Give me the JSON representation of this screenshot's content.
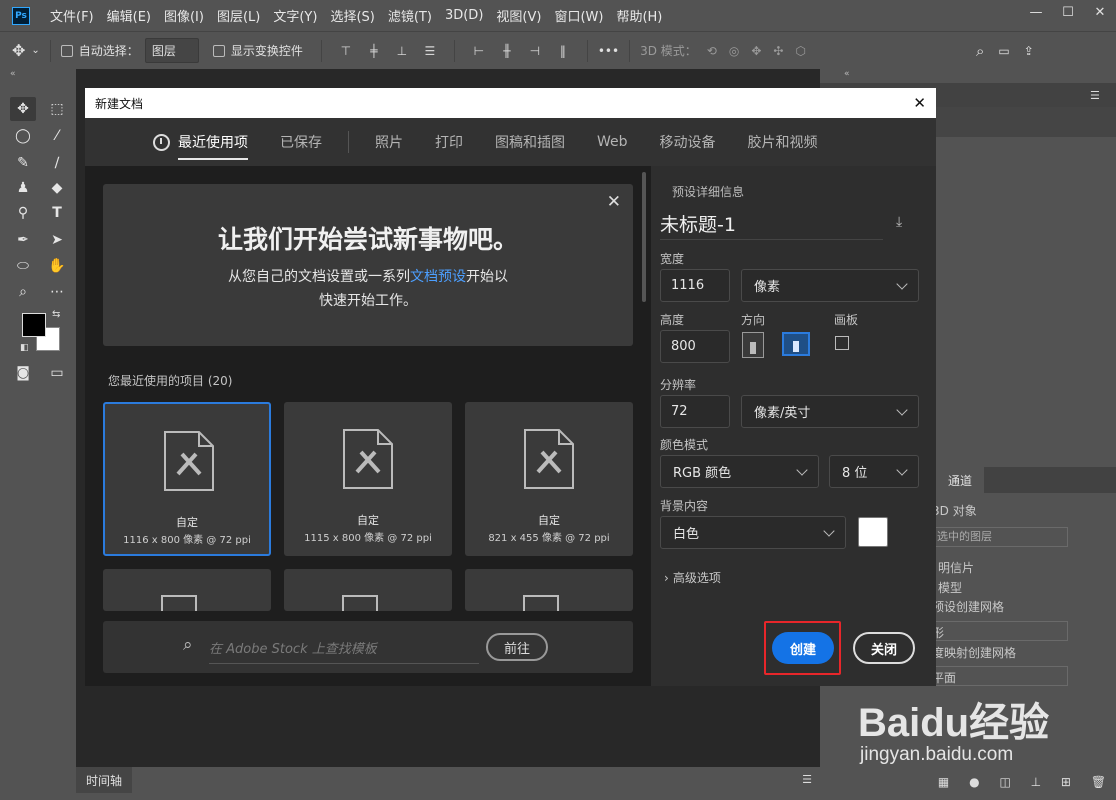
{
  "menubar": {
    "logo": "Ps",
    "items": [
      "文件(F)",
      "编辑(E)",
      "图像(I)",
      "图层(L)",
      "文字(Y)",
      "选择(S)",
      "滤镜(T)",
      "3D(D)",
      "视图(V)",
      "窗口(W)",
      "帮助(H)"
    ],
    "window_controls": [
      "—",
      "☐",
      "✕"
    ]
  },
  "options": {
    "auto_select_label": "自动选择：",
    "auto_select_value": "图层",
    "show_transform_label": "显示变换控件",
    "more": "•••",
    "mode_3d": "3D 模式："
  },
  "timeline": {
    "label": "时间轴"
  },
  "dialog": {
    "title": "新建文档",
    "close": "✕",
    "tabs": [
      "最近使用项",
      "已保存",
      "照片",
      "打印",
      "图稿和插图",
      "Web",
      "移动设备",
      "胶片和视频"
    ],
    "welcome": {
      "heading": "让我们开始尝试新事物吧。",
      "line1_before": "从您自己的文档设置或一系列",
      "line1_link": "文档预设",
      "line1_after": "开始以",
      "line2": "快速开始工作。",
      "close": "✕"
    },
    "recent_label": "您最近使用的项目",
    "recent_count": "(20)",
    "recent_items": [
      {
        "name": "自定",
        "size": "1116 x 800 像素 @ 72 ppi"
      },
      {
        "name": "自定",
        "size": "1115 x 800 像素 @ 72 ppi"
      },
      {
        "name": "自定",
        "size": "821 x 455 像素 @ 72 ppi"
      }
    ],
    "stock_placeholder": "在 Adobe Stock 上查找模板",
    "stock_go": "前往",
    "preset": {
      "section_title": "预设详细信息",
      "doc_name": "未标题-1",
      "width_label": "宽度",
      "width_value": "1116",
      "width_unit": "像素",
      "height_label": "高度",
      "height_value": "800",
      "orientation_label": "方向",
      "artboard_label": "画板",
      "resolution_label": "分辨率",
      "resolution_value": "72",
      "resolution_unit": "像素/英寸",
      "color_mode_label": "颜色模式",
      "color_mode_value": "RGB 颜色",
      "bit_depth_value": "8 位",
      "background_label": "背景内容",
      "background_value": "白色",
      "background_color": "#ffffff",
      "advanced_label": "高级选项",
      "create_button": "创建",
      "close_button": "关闭"
    }
  },
  "right_panel": {
    "tab": "通道",
    "title": "3D 对象",
    "select_value": "选中的图层",
    "items": [
      "明信片",
      "模型",
      "预设创建网格",
      "形",
      "度映射创建网格",
      "平面"
    ]
  },
  "watermark": {
    "brand": "Baidu经验",
    "url": "jingyan.baidu.com"
  },
  "colors": {
    "accent_blue": "#1473e6",
    "highlight_red": "#e8262a",
    "link_blue": "#4c9fff"
  }
}
